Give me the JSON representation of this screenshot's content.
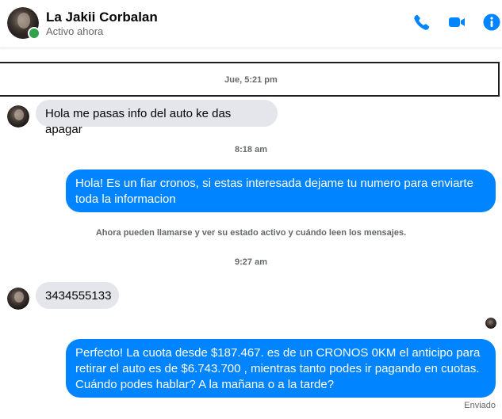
{
  "header": {
    "contact_name": "La Jakii Corbalan",
    "status": "Activo ahora",
    "accent_color": "#0084ff",
    "online_color": "#31a24c",
    "icons": [
      "phone-icon",
      "video-camera-icon",
      "info-icon"
    ]
  },
  "conversation": {
    "divider_time": "Jue, 5:21 pm",
    "messages": [
      {
        "direction": "incoming",
        "text": "Hola me pasas info del auto ke das apagar"
      },
      {
        "time": "8:18 am"
      },
      {
        "direction": "outgoing",
        "lines": [
          "Hola! Es un fiar cronos, si estas interesada dejame tu numero para enviarte",
          "toda la informacion"
        ]
      },
      {
        "system": "Ahora pueden llamarse y ver su estado activo y cuándo leen los mensajes."
      },
      {
        "time": "9:27 am"
      },
      {
        "direction": "incoming",
        "text": "3434555133"
      },
      {
        "direction": "outgoing",
        "lines": [
          "Perfecto! La cuota desde $187.467. es de un CRONOS 0KM el anticipo para",
          "retirar el auto es de $6.743.700 , mientras tanto podes ir pagando en cuotas.",
          "Cuándo podes hablar? A la mañana o a la tarde?"
        ]
      }
    ],
    "sent_status": "Enviado"
  }
}
